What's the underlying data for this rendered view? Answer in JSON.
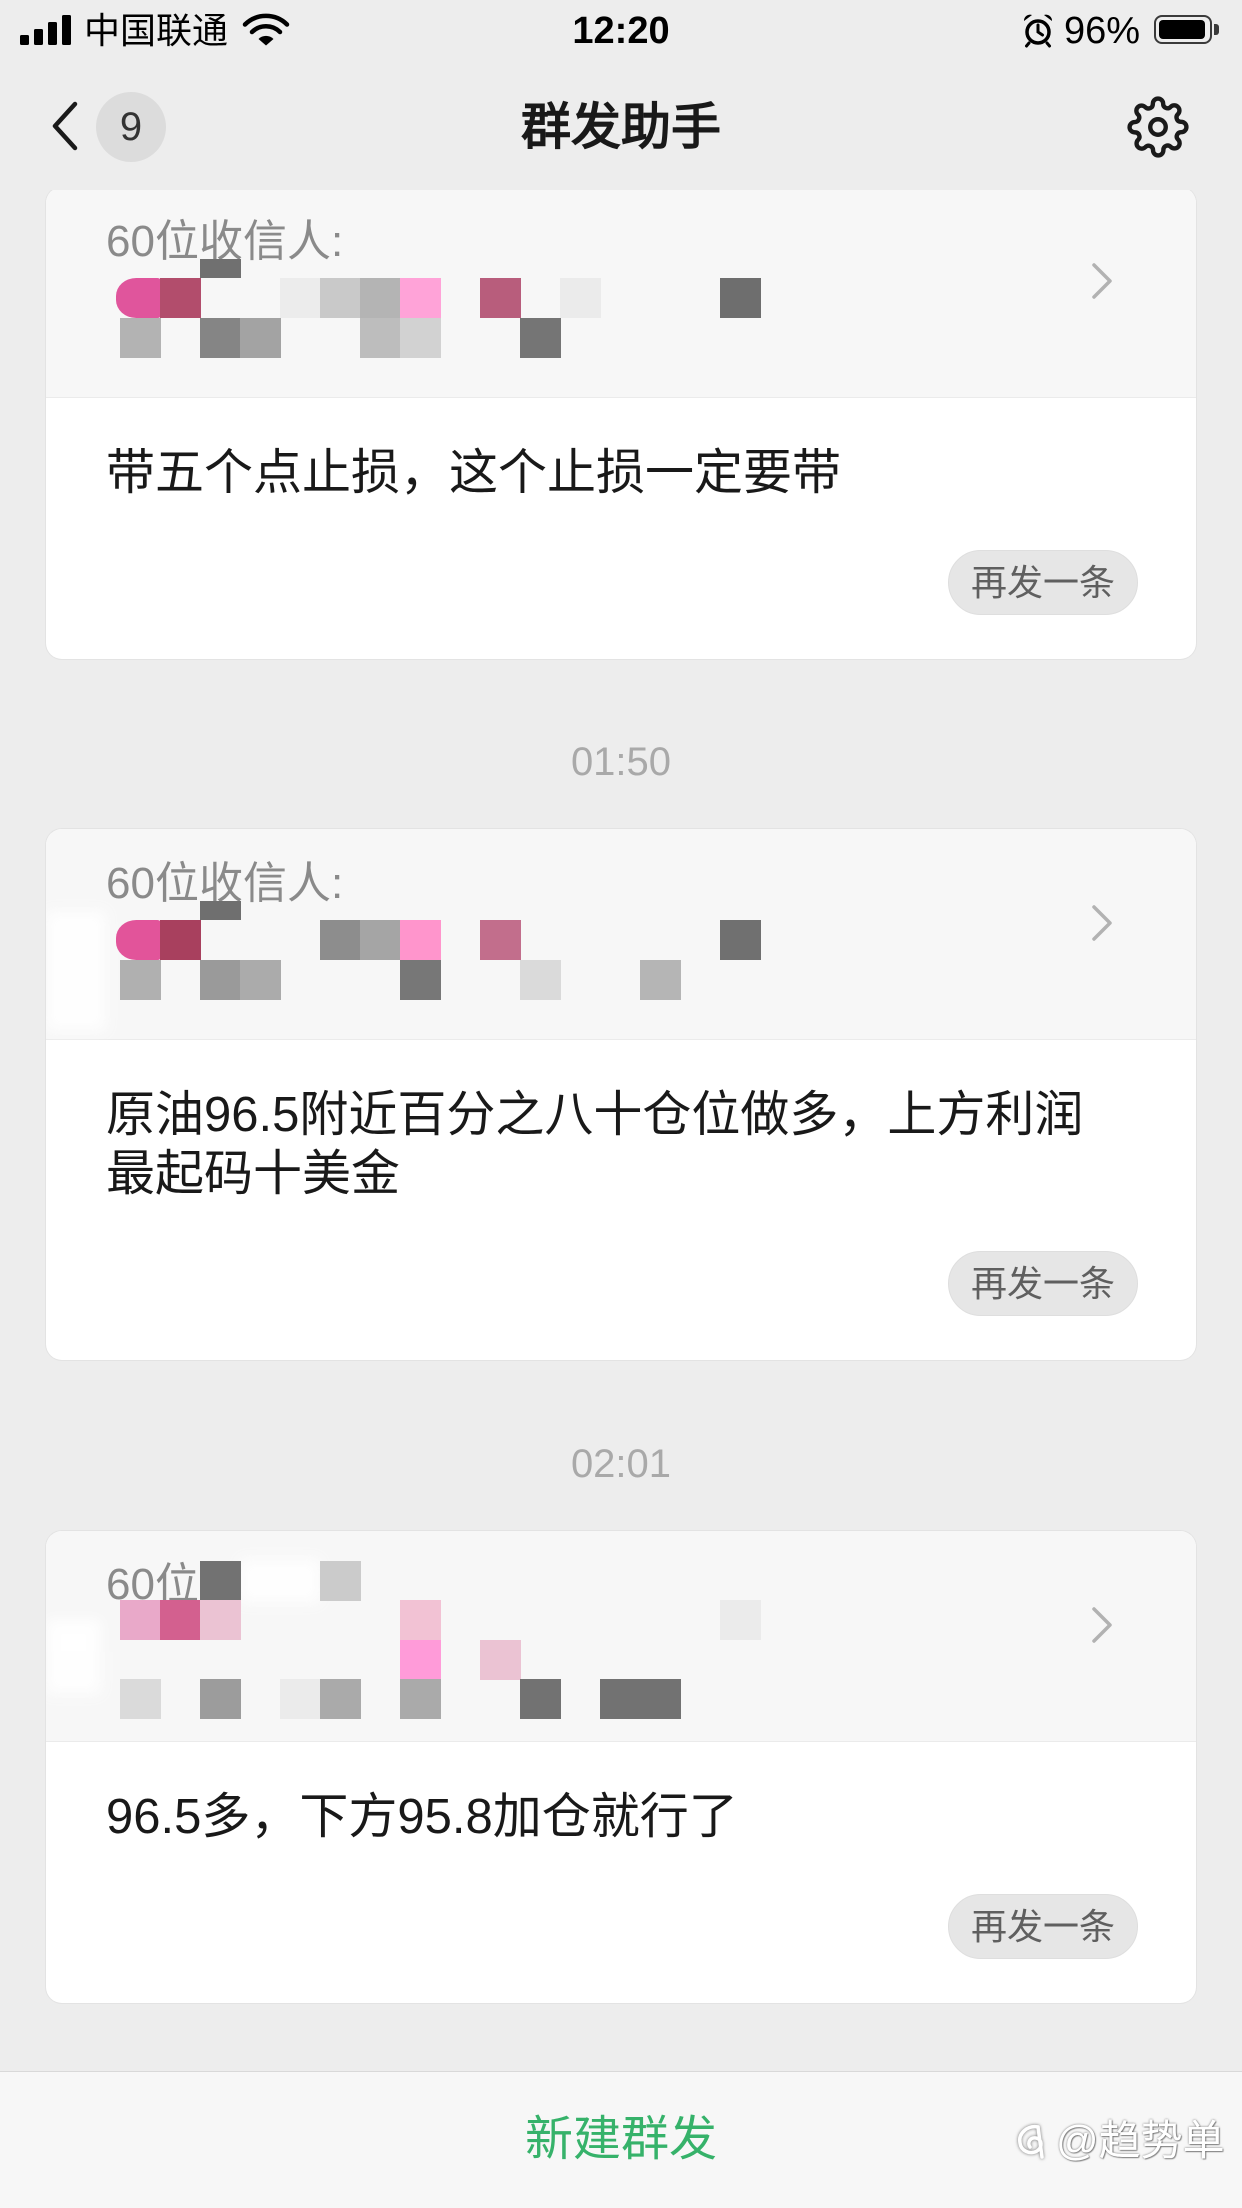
{
  "status_bar": {
    "carrier": "中国联通",
    "time": "12:20",
    "battery_text": "96%",
    "battery_level": 0.96
  },
  "nav": {
    "back_badge": "9",
    "title": "群发助手"
  },
  "messages": [
    {
      "recipients_label": "60位收信人:",
      "text_lines": [
        "带五个点止损，这个止损一定要带"
      ],
      "resend_label": "再发一条"
    },
    {
      "timestamp": "01:50",
      "recipients_label": "60位收信人:",
      "text_lines": [
        "原油96.5附近百分之八十仓位做多，上方利润",
        "最起码十美金"
      ],
      "resend_label": "再发一条"
    },
    {
      "timestamp": "02:01",
      "recipients_label": "60位",
      "text_lines": [
        "96.5多，下方95.8加仓就行了"
      ],
      "resend_label": "再发一条"
    }
  ],
  "footer": {
    "new_broadcast_label": "新建群发"
  },
  "watermark": {
    "text": "@趋势单"
  },
  "icons": {
    "signal": "cellular-signal-icon",
    "wifi": "wifi-icon",
    "alarm": "alarm-clock-icon",
    "battery": "battery-icon",
    "back": "chevron-left-icon",
    "settings": "gear-icon",
    "recipients_arrow": "chevron-right-icon",
    "watermark_logo": "watermark-logo-icon"
  },
  "colors": {
    "page_background": "#ededed",
    "card_background": "#ffffff",
    "card_header_background": "#f7f7f7",
    "primary_text": "#191919",
    "secondary_text": "#8a8a8a",
    "timestamp_text": "#a9a9a9",
    "resend_button_background": "#e6e6e6",
    "accent_green": "#36b26a"
  }
}
